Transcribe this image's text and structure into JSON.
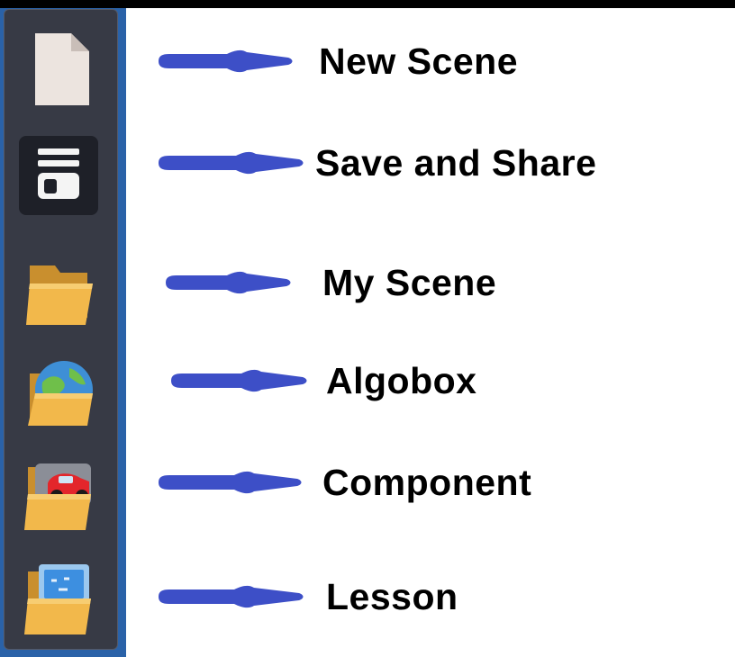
{
  "toolbar": {
    "items": [
      {
        "id": "new-scene",
        "label": "New Scene",
        "icon": "blank-document-icon"
      },
      {
        "id": "save-share",
        "label": "Save and Share",
        "icon": "save-drive-icon"
      },
      {
        "id": "my-scene",
        "label": "My Scene",
        "icon": "folder-icon"
      },
      {
        "id": "algobox",
        "label": "Algobox",
        "icon": "globe-folder-icon"
      },
      {
        "id": "component",
        "label": "Component",
        "icon": "car-folder-icon"
      },
      {
        "id": "lesson",
        "label": "Lesson",
        "icon": "screen-folder-icon"
      }
    ]
  },
  "colors": {
    "sidebar_background": "#373a45",
    "sidebar_frame": "#2a62a8",
    "arrow": "#3d4fc7",
    "folder": "#f2b84b",
    "label_text": "#000000"
  }
}
